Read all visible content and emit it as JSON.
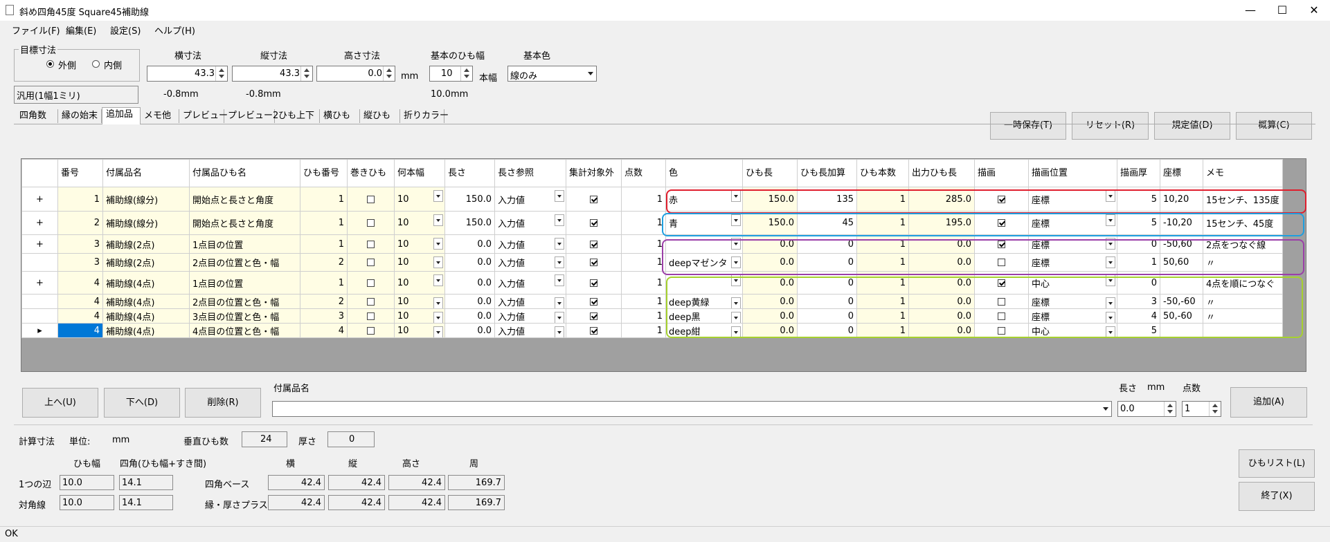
{
  "window": {
    "title": "斜め四角45度 Square45補助線",
    "minimize": "—",
    "maximize": "☐",
    "close": "✕"
  },
  "menu": [
    "ファイル(F)",
    "編集(E)",
    "設定(S)",
    "ヘルプ(H)"
  ],
  "target": {
    "legend": "目標寸法",
    "outer": "外側",
    "inner": "内側"
  },
  "dims": {
    "width_label": "横寸法",
    "width_value": "43.3",
    "height_label": "縦寸法",
    "height_value": "43.3",
    "depth_label": "高さ寸法",
    "depth_value": "0.0",
    "unit": "mm",
    "band_label": "基本のひも幅",
    "band_value": "10",
    "band_unit": "本幅",
    "color_label": "基本色",
    "color_value": "線のみ"
  },
  "preset": "汎用(1幅1ミリ)",
  "diffs": {
    "width": "-0.8mm",
    "height": "-0.8mm",
    "band": "10.0mm"
  },
  "top_buttons": [
    "一時保存(T)",
    "リセット(R)",
    "規定値(D)",
    "概算(C)"
  ],
  "tabs": [
    "四角数",
    "縁の始末",
    "追加品",
    "メモ他",
    "プレビュー",
    "プレビュー2",
    "ひも上下",
    "横ひも",
    "縦ひも",
    "折りカラー"
  ],
  "grid": {
    "headers": [
      "",
      "番号",
      "付属品名",
      "付属品ひも名",
      "ひも番号",
      "巻きひも",
      "何本幅",
      "長さ",
      "長さ参照",
      "集計対象外",
      "点数",
      "色",
      "ひも長",
      "ひも長加算",
      "ひも本数",
      "出力ひも長",
      "描画",
      "描画位置",
      "描画厚",
      "座標",
      "メモ"
    ],
    "rows": [
      {
        "exp": "+",
        "no": "1",
        "name": "補助線(線分)",
        "band": "開始点と長さと角度",
        "bno": "1",
        "wrap": false,
        "w": "10",
        "len": "150.0",
        "ref": "入力値",
        "exc": true,
        "pts": "1",
        "color": "赤",
        "blen": "150.0",
        "add": "135",
        "cnt": "1",
        "out": "285.0",
        "draw": true,
        "pos": "座標",
        "thick": "5",
        "coord": "10,20",
        "memo": "15センチ、135度"
      },
      {
        "exp": "+",
        "no": "2",
        "name": "補助線(線分)",
        "band": "開始点と長さと角度",
        "bno": "1",
        "wrap": false,
        "w": "10",
        "len": "150.0",
        "ref": "入力値",
        "exc": true,
        "pts": "1",
        "color": "青",
        "blen": "150.0",
        "add": "45",
        "cnt": "1",
        "out": "195.0",
        "draw": true,
        "pos": "座標",
        "thick": "5",
        "coord": "-10,20",
        "memo": "15センチ、45度"
      },
      {
        "exp": "+",
        "no": "3",
        "name": "補助線(2点)",
        "band": "1点目の位置",
        "bno": "1",
        "wrap": false,
        "w": "10",
        "len": "0.0",
        "ref": "入力値",
        "exc": true,
        "pts": "1",
        "color": "",
        "blen": "0.0",
        "add": "0",
        "cnt": "1",
        "out": "0.0",
        "draw": true,
        "pos": "座標",
        "thick": "0",
        "coord": "-50,60",
        "memo": "2点をつなぐ線"
      },
      {
        "exp": "",
        "no": "3",
        "name": "補助線(2点)",
        "band": "2点目の位置と色・幅",
        "bno": "2",
        "wrap": false,
        "w": "10",
        "len": "0.0",
        "ref": "入力値",
        "exc": true,
        "pts": "1",
        "color": "deepマゼンタ",
        "blen": "0.0",
        "add": "0",
        "cnt": "1",
        "out": "0.0",
        "draw": false,
        "pos": "座標",
        "thick": "1",
        "coord": "50,60",
        "memo": "〃"
      },
      {
        "exp": "+",
        "no": "4",
        "name": "補助線(4点)",
        "band": "1点目の位置",
        "bno": "1",
        "wrap": false,
        "w": "10",
        "len": "0.0",
        "ref": "入力値",
        "exc": true,
        "pts": "1",
        "color": "",
        "blen": "0.0",
        "add": "0",
        "cnt": "1",
        "out": "0.0",
        "draw": true,
        "pos": "中心",
        "thick": "0",
        "coord": "",
        "memo": "4点を順につなぐ"
      },
      {
        "exp": "",
        "no": "4",
        "name": "補助線(4点)",
        "band": "2点目の位置と色・幅",
        "bno": "2",
        "wrap": false,
        "w": "10",
        "len": "0.0",
        "ref": "入力値",
        "exc": true,
        "pts": "1",
        "color": "deep黄緑",
        "blen": "0.0",
        "add": "0",
        "cnt": "1",
        "out": "0.0",
        "draw": false,
        "pos": "座標",
        "thick": "3",
        "coord": "-50,-60",
        "memo": "〃"
      },
      {
        "exp": "",
        "no": "4",
        "name": "補助線(4点)",
        "band": "3点目の位置と色・幅",
        "bno": "3",
        "wrap": false,
        "w": "10",
        "len": "0.0",
        "ref": "入力値",
        "exc": true,
        "pts": "1",
        "color": "deep黒",
        "blen": "0.0",
        "add": "0",
        "cnt": "1",
        "out": "0.0",
        "draw": false,
        "pos": "座標",
        "thick": "4",
        "coord": "50,-60",
        "memo": "〃"
      },
      {
        "exp": "▸",
        "no": "4",
        "name": "補助線(4点)",
        "band": "4点目の位置と色・幅",
        "bno": "4",
        "wrap": false,
        "w": "10",
        "len": "0.0",
        "ref": "入力値",
        "exc": true,
        "pts": "1",
        "color": "deep紺",
        "blen": "0.0",
        "add": "0",
        "cnt": "1",
        "out": "0.0",
        "draw": false,
        "pos": "中心",
        "thick": "5",
        "coord": "",
        "memo": ""
      }
    ]
  },
  "action_buttons": {
    "up": "上へ(U)",
    "down": "下へ(D)",
    "delete": "削除(R)",
    "add": "追加(A)"
  },
  "accessory": {
    "label": "付属品名",
    "value": "",
    "len_label": "長さ",
    "len_unit": "mm",
    "len_value": "0.0",
    "pts_label": "点数",
    "pts_value": "1"
  },
  "calc": {
    "label": "計算寸法",
    "unit_label": "単位:",
    "unit_value": "mm",
    "vert_label": "垂直ひも数",
    "vert_value": "24",
    "thick_label": "厚さ",
    "thick_value": "0",
    "col_band": "ひも幅",
    "col_square": "四角(ひも幅+すき間)",
    "col_w": "横",
    "col_h": "縦",
    "col_d": "高さ",
    "col_p": "周",
    "side_label": "1つの辺",
    "side_band": "10.0",
    "side_square": "14.1",
    "diag_label": "対角線",
    "diag_band": "10.0",
    "diag_square": "14.1",
    "base_label": "四角ベース",
    "base": [
      "42.4",
      "42.4",
      "42.4",
      "169.7"
    ],
    "edge_label": "縁・厚さプラス",
    "edge": [
      "42.4",
      "42.4",
      "42.4",
      "169.7"
    ]
  },
  "side_buttons": {
    "list": "ひもリスト(L)",
    "exit": "終了(X)"
  },
  "status": "OK",
  "colors": {
    "red": "#e01e2d",
    "blue": "#1e9fe0",
    "purple": "#9b3fa8",
    "lime": "#a6d12e",
    "selection": "#0078d7"
  }
}
